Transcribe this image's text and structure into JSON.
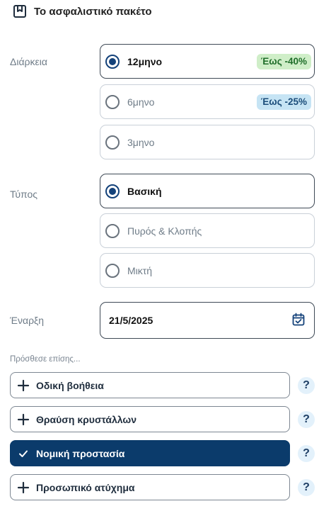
{
  "header": {
    "title": "Το ασφαλιστικό πακέτο",
    "icon": "bookmark-box-icon"
  },
  "duration": {
    "label": "Διάρκεια",
    "options": [
      {
        "label": "12μηνο",
        "selected": true,
        "badge": "Έως -40%",
        "badge_color": "#cfeec8"
      },
      {
        "label": "6μηνο",
        "selected": false,
        "badge": "Έως -25%",
        "badge_color": "#c6e4f4"
      },
      {
        "label": "3μηνο",
        "selected": false
      }
    ]
  },
  "type": {
    "label": "Τύπος",
    "options": [
      {
        "label": "Βασική",
        "selected": true
      },
      {
        "label": "Πυρός & Κλοπής",
        "selected": false
      },
      {
        "label": "Μικτή",
        "selected": false
      }
    ]
  },
  "start": {
    "label": "Έναρξη",
    "value": "21/5/2025",
    "icon": "calendar-check-icon"
  },
  "addons": {
    "hint": "Πρόσθεσε επίσης...",
    "items": [
      {
        "label": "Οδική βοήθεια",
        "selected": false,
        "help": "?"
      },
      {
        "label": "Θραύση κρυστάλλων",
        "selected": false,
        "help": "?"
      },
      {
        "label": "Νομική προστασία",
        "selected": true,
        "help": "?"
      },
      {
        "label": "Προσωπικό ατύχημα",
        "selected": false,
        "help": "?"
      }
    ]
  },
  "colors": {
    "primary": "#0b3b6b",
    "radio": "#14427a",
    "help_bg": "#e3f1fb"
  }
}
